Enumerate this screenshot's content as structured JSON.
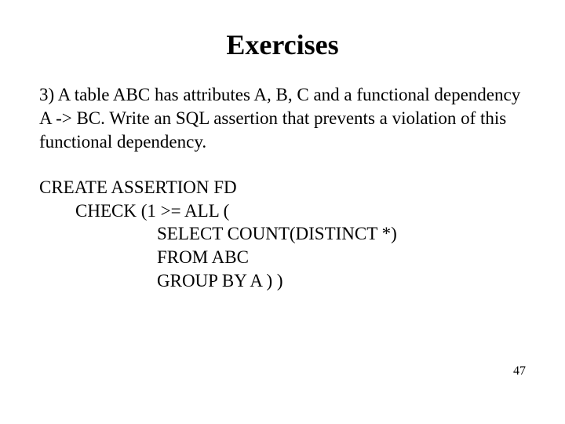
{
  "title": "Exercises",
  "question": "3) A table ABC has attributes A, B, C and a functional dependency A -> BC. Write an SQL assertion that prevents a violation of this functional dependency.",
  "code": {
    "line1": "CREATE ASSERTION FD",
    "line2": "CHECK  (1 >= ALL (",
    "line3": "SELECT COUNT(DISTINCT *)",
    "line4": "FROM ABC",
    "line5": "GROUP BY A ) )"
  },
  "page_number": "47"
}
